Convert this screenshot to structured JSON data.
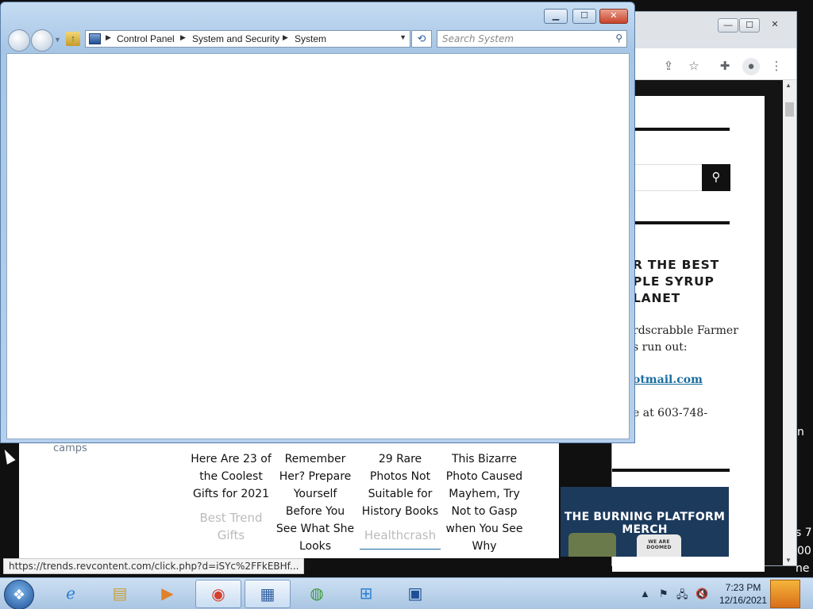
{
  "explorer": {
    "breadcrumbs": [
      "Control Panel",
      "System and Security",
      "System"
    ],
    "search_placeholder": "Search System",
    "controls": {
      "minimize": "▁",
      "maximize": "☐",
      "close": "✕"
    }
  },
  "chrome": {
    "window_controls": {
      "minimize": "—",
      "maximize": "☐",
      "close": "✕"
    },
    "toolbar_icons": [
      "share-icon",
      "star-icon",
      "extensions-icon",
      "profile-icon",
      "menu-icon"
    ]
  },
  "webpage": {
    "syrup_heading": "R THE BEST\nPLE SYRUP\nLANET",
    "syrup_text": "rdscrabble Farmer\ns run out:",
    "syrup_email": "otmail.com",
    "syrup_phone": "e at 603-748-",
    "merch_banner": "THE BURNING PLATFORM MERCH",
    "merch_shirt_text": "WE ARE DOOMED",
    "camps_text": "camps",
    "ads": [
      {
        "title": "Here Are 23 of the Coolest Gifts for 2021",
        "source": "Best Trend Gifts"
      },
      {
        "title": "Remember Her? Prepare Yourself Before You See What She Looks",
        "source": ""
      },
      {
        "title": "29 Rare Photos Not Suitable for History Books",
        "source": "Healthcrash"
      },
      {
        "title": "This Bizarre Photo Caused Mayhem, Try Not to Gasp when You See Why",
        "source": ""
      }
    ],
    "status_url": "https://trends.revcontent.com/click.php?d=iSYc%2FFkEBHf..."
  },
  "desktop_fragments": [
    "n",
    "s 7",
    "00",
    "ne"
  ],
  "taskbar": {
    "items": [
      "internet-explorer-icon",
      "file-explorer-icon",
      "media-player-icon",
      "chrome-icon",
      "control-panel-icon",
      "windows-update-icon",
      "windows-logo-icon",
      "rdp-icon"
    ],
    "clock_time": "7:23 PM",
    "clock_date": "12/16/2021"
  },
  "colors": {
    "explorer_frame": "#a7c6e6",
    "close_red": "#c8432a",
    "taskbar": "#a9c5e2",
    "link_blue": "#1a6ea0"
  }
}
